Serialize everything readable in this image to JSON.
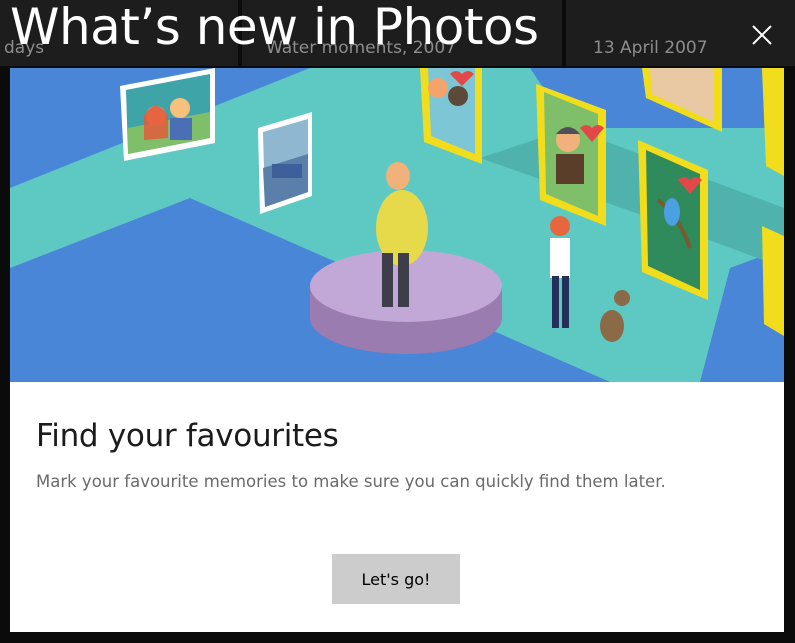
{
  "dialog": {
    "title": "What’s new in Photos",
    "close_icon": "close-icon",
    "illustration": "gallery-favourites-illustration",
    "heading": "Find your favourites",
    "description": "Mark your favourite memories to make sure you can quickly find them later.",
    "cta_label": "Let's go!"
  },
  "background": {
    "labels": [
      "days",
      "Water moments, 2007",
      "13 April 2007"
    ]
  },
  "colors": {
    "hero_floor": "#5ec9c3",
    "hero_path": "#4a86d8",
    "frame_yellow": "#f2dd1c",
    "platform": "#b89ccc",
    "button": "#cccccc",
    "panel": "#ffffff"
  }
}
